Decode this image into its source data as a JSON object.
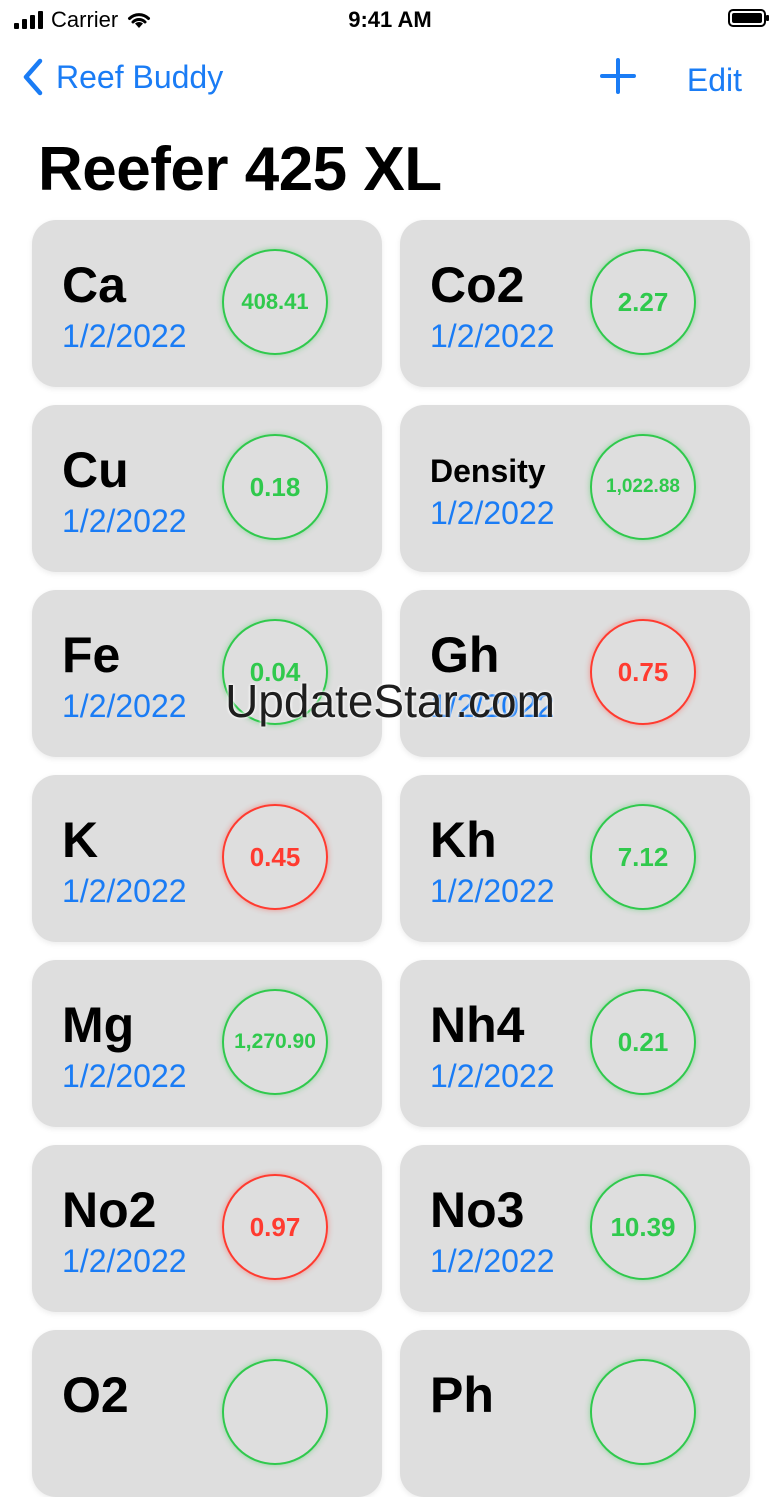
{
  "status_bar": {
    "carrier": "Carrier",
    "time": "9:41 AM",
    "icons": [
      "cellular-signal-icon",
      "wifi-icon",
      "battery-icon"
    ]
  },
  "nav": {
    "back_label": "Reef Buddy",
    "back_icon": "chevron-left-icon",
    "add_icon": "plus-icon",
    "edit_label": "Edit"
  },
  "page": {
    "title": "Reefer 425 XL"
  },
  "colors": {
    "accent": "#1a7cf5",
    "ok": "#30c94d",
    "alert": "#ff3b30",
    "card": "#dedede"
  },
  "parameters": [
    {
      "name": "Ca",
      "date": "1/2/2022",
      "value": "408.41",
      "status": "green"
    },
    {
      "name": "Co2",
      "date": "1/2/2022",
      "value": "2.27",
      "status": "green"
    },
    {
      "name": "Cu",
      "date": "1/2/2022",
      "value": "0.18",
      "status": "green"
    },
    {
      "name": "Density",
      "date": "1/2/2022",
      "value": "1,022.88",
      "status": "green"
    },
    {
      "name": "Fe",
      "date": "1/2/2022",
      "value": "0.04",
      "status": "green"
    },
    {
      "name": "Gh",
      "date": "1/2/2022",
      "value": "0.75",
      "status": "red"
    },
    {
      "name": "K",
      "date": "1/2/2022",
      "value": "0.45",
      "status": "red"
    },
    {
      "name": "Kh",
      "date": "1/2/2022",
      "value": "7.12",
      "status": "green"
    },
    {
      "name": "Mg",
      "date": "1/2/2022",
      "value": "1,270.90",
      "status": "green"
    },
    {
      "name": "Nh4",
      "date": "1/2/2022",
      "value": "0.21",
      "status": "green"
    },
    {
      "name": "No2",
      "date": "1/2/2022",
      "value": "0.97",
      "status": "red"
    },
    {
      "name": "No3",
      "date": "1/2/2022",
      "value": "10.39",
      "status": "green"
    },
    {
      "name": "O2",
      "date": "",
      "value": "",
      "status": "green"
    },
    {
      "name": "Ph",
      "date": "",
      "value": "",
      "status": "green"
    }
  ],
  "watermark": "UpdateStar.com"
}
